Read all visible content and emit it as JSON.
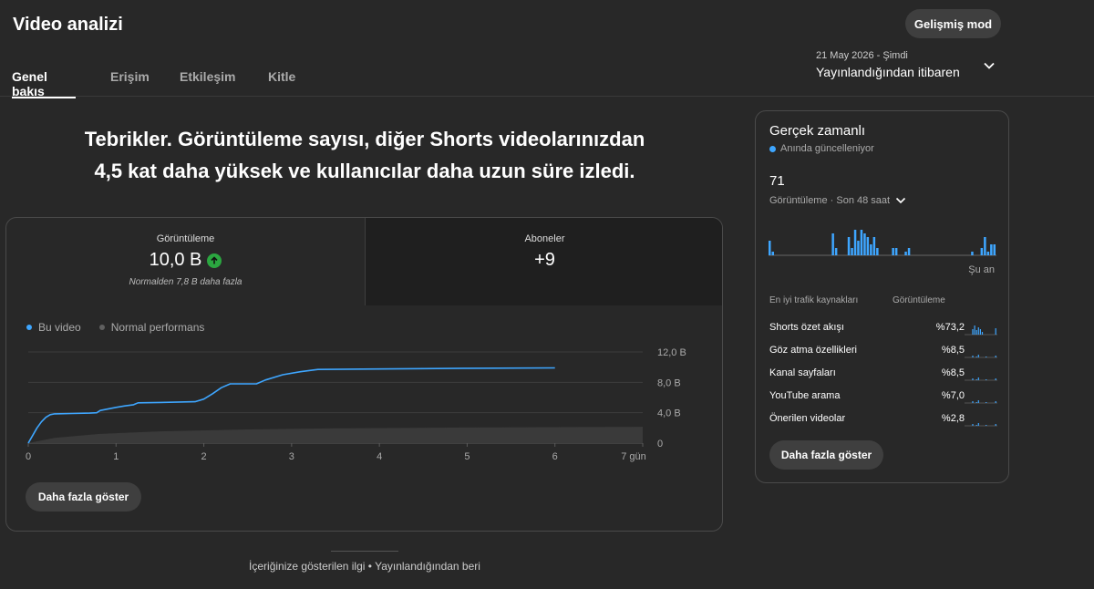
{
  "header": {
    "title": "Video analizi",
    "advanced_button": "Gelişmiş mod"
  },
  "tabs": [
    {
      "label": "Genel bakış",
      "active": true
    },
    {
      "label": "Erişim",
      "active": false
    },
    {
      "label": "Etkileşim",
      "active": false
    },
    {
      "label": "Kitle",
      "active": false
    }
  ],
  "date_selector": {
    "range": "21 May 2026 - Şimdi",
    "label": "Yayınlandığından itibaren",
    "icon": "chevron-down-icon"
  },
  "headline": {
    "line1": "Tebrikler. Görüntüleme sayısı, diğer Shorts videolarınızdan",
    "line2": "4,5 kat daha yüksek ve kullanıcılar daha uzun süre izledi."
  },
  "metrics": {
    "views": {
      "label": "Görüntüleme",
      "value": "10,0 B",
      "note": "Normalden 7,8 B daha fazla",
      "icon": "arrow-up-icon"
    },
    "subscribers": {
      "label": "Aboneler",
      "value": "+9"
    }
  },
  "chart_data": {
    "type": "line",
    "x_unit": "gün",
    "xlim": [
      0,
      7
    ],
    "ylim": [
      0,
      12000
    ],
    "x_ticks": [
      "0",
      "1",
      "2",
      "3",
      "4",
      "5",
      "6",
      "7 gün"
    ],
    "y_ticks": [
      "12,0 B",
      "8,0 B",
      "4,0 B",
      "0"
    ],
    "legend_position": "top-left",
    "series": [
      {
        "name": "Bu video",
        "color": "#3ea6ff",
        "points": [
          [
            0,
            0
          ],
          [
            0.05,
            1000
          ],
          [
            0.1,
            2000
          ],
          [
            0.15,
            2800
          ],
          [
            0.2,
            3400
          ],
          [
            0.25,
            3750
          ],
          [
            0.3,
            3850
          ],
          [
            0.5,
            3900
          ],
          [
            0.7,
            3950
          ],
          [
            0.78,
            4000
          ],
          [
            0.82,
            4300
          ],
          [
            1.0,
            4700
          ],
          [
            1.1,
            4900
          ],
          [
            1.2,
            5050
          ],
          [
            1.25,
            5300
          ],
          [
            1.5,
            5350
          ],
          [
            1.9,
            5450
          ],
          [
            2.0,
            5800
          ],
          [
            2.1,
            6500
          ],
          [
            2.2,
            7300
          ],
          [
            2.3,
            7800
          ],
          [
            2.6,
            7800
          ],
          [
            2.7,
            8300
          ],
          [
            2.9,
            9000
          ],
          [
            3.1,
            9400
          ],
          [
            3.3,
            9700
          ],
          [
            3.8,
            9750
          ],
          [
            4.5,
            9800
          ],
          [
            5.0,
            9850
          ],
          [
            6.0,
            9900
          ]
        ]
      },
      {
        "name": "Normal performans",
        "color": "#606060",
        "points": [
          [
            0,
            0
          ],
          [
            0.3,
            700
          ],
          [
            0.8,
            1200
          ],
          [
            1.5,
            1550
          ],
          [
            2.5,
            1800
          ],
          [
            3.5,
            1950
          ],
          [
            5,
            2050
          ],
          [
            7,
            2150
          ]
        ]
      }
    ]
  },
  "more_button": "Daha fazla göster",
  "footer": {
    "text": "İçeriğinize gösterilen ilgi • Yayınlandığından beri"
  },
  "realtime": {
    "title": "Gerçek zamanlı",
    "live_text": "Anında güncelleniyor",
    "live_color": "#3ea6ff",
    "count": "71",
    "sub_label": "Görüntüleme · Son 48 saat",
    "now_label": "Şu an",
    "bars": [
      4,
      1,
      0,
      0,
      0,
      0,
      0,
      0,
      0,
      0,
      0,
      0,
      0,
      0,
      0,
      0,
      0,
      0,
      0,
      0,
      6,
      2,
      0,
      0,
      0,
      5,
      2,
      7,
      4,
      7,
      6,
      5,
      3,
      5,
      2,
      0,
      0,
      0,
      0,
      2,
      2,
      0,
      0,
      1,
      2,
      0,
      0,
      0,
      0,
      0,
      0,
      0,
      0,
      0,
      0,
      0,
      0,
      0,
      0,
      0,
      0,
      0,
      0,
      0,
      1,
      0,
      0,
      2,
      5,
      1,
      3,
      3
    ],
    "table_header": {
      "source": "En iyi trafik kaynakları",
      "views": "Görüntüleme"
    },
    "sources": [
      {
        "name": "Shorts özet akışı",
        "pct": "%73,2"
      },
      {
        "name": "Göz atma özellikleri",
        "pct": "%8,5"
      },
      {
        "name": "Kanal sayfaları",
        "pct": "%8,5"
      },
      {
        "name": "YouTube arama",
        "pct": "%7,0"
      },
      {
        "name": "Önerilen videolar",
        "pct": "%2,8"
      }
    ],
    "more_button": "Daha fazla göster"
  }
}
